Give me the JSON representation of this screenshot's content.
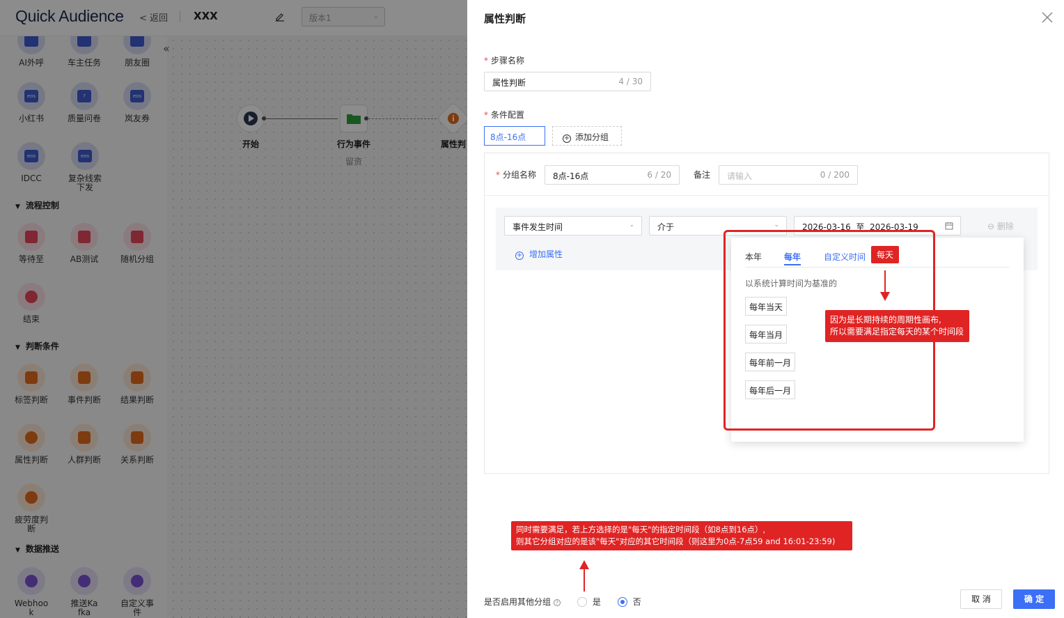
{
  "header": {
    "logo": "Quick Audience",
    "back": "返回",
    "flow_name": "XXX",
    "version": "版本1"
  },
  "sidebar": {
    "top_row": [
      "AI外呼",
      "车主任务",
      "朋友圈"
    ],
    "row2": [
      "小红书",
      "质量问卷",
      "岚友券"
    ],
    "row3": [
      "IDCC",
      "复杂线索下发"
    ],
    "section_flow": "流程控制",
    "flow_items": [
      "等待至",
      "AB测试",
      "随机分组",
      "结束"
    ],
    "section_judge": "判断条件",
    "judge_items": [
      "标签判断",
      "事件判断",
      "结果判断",
      "属性判断",
      "人群判断",
      "关系判断",
      "疲劳度判断"
    ],
    "section_push": "数据推送",
    "push_items": [
      "Webhook",
      "推送Kafka",
      "自定义事件"
    ]
  },
  "canvas": {
    "nodes": [
      {
        "label": "开始",
        "sub": ""
      },
      {
        "label": "行为事件",
        "sub": "留资"
      },
      {
        "label": "属性判",
        "sub": ""
      }
    ]
  },
  "drawer": {
    "title": "属性判断",
    "step_name_label": "步骤名称",
    "step_name_value": "属性判断",
    "step_name_count": "4 / 30",
    "condition_label": "条件配置",
    "group_tab": "8点-16点",
    "add_group": "添加分组",
    "group_name_label": "分组名称",
    "group_name_value": "8点-16点",
    "group_name_count": "6 / 20",
    "remark_label": "备注",
    "remark_placeholder": "请输入",
    "remark_count": "0 / 200",
    "attr_select": "事件发生时间",
    "op_select": "介于",
    "date_range": "2026-03-16  至  2026-03-19",
    "delete": "删除",
    "add_attr": "增加属性",
    "popup": {
      "tabs": [
        "本年",
        "每年",
        "自定义时间"
      ],
      "hint": "以系统计算时间为基准的",
      "options": [
        "每年当天",
        "每年当月",
        "每年前一月",
        "每年后一月"
      ]
    },
    "annotations": {
      "tag_daily": "每天",
      "note1_line1": "因为是长期持续的周期性画布,",
      "note1_line2": "所以需要满足指定每天的某个时间段",
      "note2_line1": "同时需要满足，若上方选择的是\"每天\"的指定时间段（如8点到16点）,",
      "note2_line2": "则其它分组对应的是该\"每天\"对应的其它时间段（则这里为0点-7点59 and 16:01-23:59)"
    },
    "footer": {
      "enable_other_label": "是否启用其他分组",
      "yes": "是",
      "no": "否",
      "selected": "否",
      "cancel": "取 消",
      "ok": "确 定"
    }
  },
  "colors": {
    "primary": "#3b6ff5",
    "annotation_red": "#e02424"
  }
}
